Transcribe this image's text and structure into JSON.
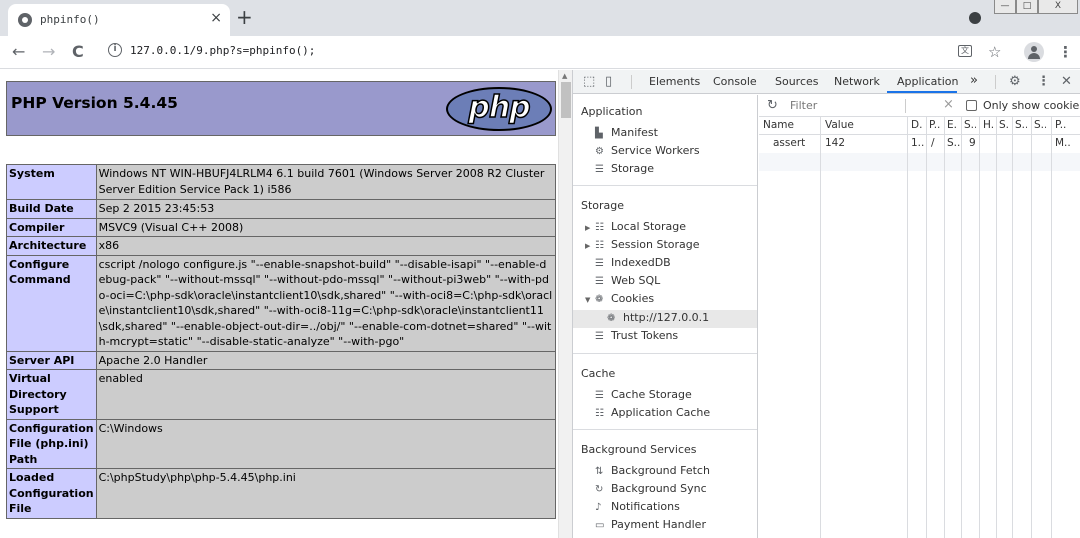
{
  "browser": {
    "tab_title": "phpinfo()",
    "tab_close": "×",
    "new_tab": "+",
    "url": "127.0.0.1/9.php?s=phpinfo();",
    "back": "←",
    "forward": "→",
    "reload": "C",
    "info_icon": "i",
    "translate_icon": "translate-icon",
    "star": "☆",
    "menu": "⋮",
    "win_minimize": "—",
    "win_maximize": "□",
    "win_close": "X"
  },
  "phpinfo": {
    "heading": "PHP Version 5.4.45",
    "logo_text": "php",
    "rows": [
      {
        "key": "System",
        "value": "Windows NT WIN-HBUFJ4LRLM4 6.1 build 7601 (Windows Server 2008 R2 Cluster Server Edition Service Pack 1) i586"
      },
      {
        "key": "Build Date",
        "value": "Sep 2 2015 23:45:53"
      },
      {
        "key": "Compiler",
        "value": "MSVC9 (Visual C++ 2008)"
      },
      {
        "key": "Architecture",
        "value": "x86"
      },
      {
        "key": "Configure Command",
        "value": "cscript /nologo configure.js \"--enable-snapshot-build\" \"--disable-isapi\" \"--enable-debug-pack\" \"--without-mssql\" \"--without-pdo-mssql\" \"--without-pi3web\" \"--with-pdo-oci=C:\\php-sdk\\oracle\\instantclient10\\sdk,shared\" \"--with-oci8=C:\\php-sdk\\oracle\\instantclient10\\sdk,shared\" \"--with-oci8-11g=C:\\php-sdk\\oracle\\instantclient11\\sdk,shared\" \"--enable-object-out-dir=../obj/\" \"--enable-com-dotnet=shared\" \"--with-mcrypt=static\" \"--disable-static-analyze\" \"--with-pgo\""
      },
      {
        "key": "Server API",
        "value": "Apache 2.0 Handler"
      },
      {
        "key": "Virtual Directory Support",
        "value": "enabled"
      },
      {
        "key": "Configuration File (php.ini) Path",
        "value": "C:\\Windows"
      },
      {
        "key": "Loaded Configuration File",
        "value": "C:\\phpStudy\\php\\php-5.4.45\\php.ini"
      }
    ]
  },
  "devtools": {
    "tabs": [
      "Elements",
      "Console",
      "Sources",
      "Network",
      "Application"
    ],
    "more_tabs": "»",
    "active_tab": "Application",
    "sidebar": {
      "application_title": "Application",
      "application_items": [
        "Manifest",
        "Service Workers",
        "Storage"
      ],
      "storage_title": "Storage",
      "storage_items": [
        "Local Storage",
        "Session Storage",
        "IndexedDB",
        "Web SQL",
        "Cookies"
      ],
      "cookie_origin": "http://127.0.0.1",
      "trust_tokens": "Trust Tokens",
      "cache_title": "Cache",
      "cache_items": [
        "Cache Storage",
        "Application Cache"
      ],
      "background_title": "Background Services",
      "background_items": [
        "Background Fetch",
        "Background Sync",
        "Notifications",
        "Payment Handler"
      ]
    },
    "filter_placeholder": "Filter",
    "filter_clear": "×",
    "only_show_label": "Only show cookies w",
    "columns": [
      "Name",
      "Value",
      "D.",
      "P..",
      "E.",
      "S..",
      "H.",
      "S.",
      "S..",
      "S..",
      "P.."
    ],
    "cookies": [
      {
        "name": "assert",
        "value": "142",
        "domain": "1...",
        "path": "/",
        "expires": "S...",
        "size": "9",
        "priority": "M.."
      }
    ]
  }
}
